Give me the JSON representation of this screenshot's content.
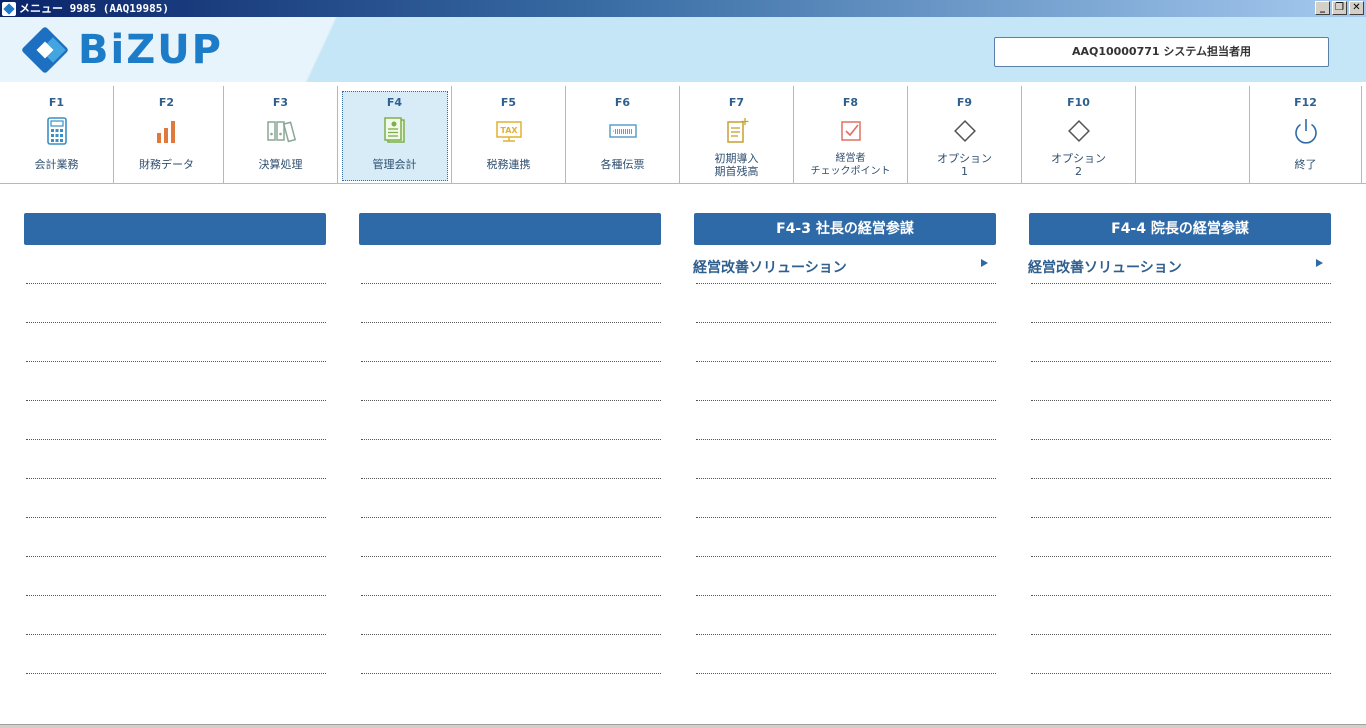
{
  "window": {
    "title": "メニュー 9985 (AAQ19985)",
    "controls": {
      "minimize": "_",
      "restore": "❐",
      "close": "✕"
    }
  },
  "header": {
    "logo_text": "BiZUP",
    "user_label": "AAQ10000771 システム担当者用"
  },
  "fkeys": [
    {
      "key": "F1",
      "label": "会計業務",
      "icon": "calculator-icon",
      "color": "#3a8fc4"
    },
    {
      "key": "F2",
      "label": "財務データ",
      "icon": "bar-chart-icon",
      "color": "#e07a3c"
    },
    {
      "key": "F3",
      "label": "決算処理",
      "icon": "binders-icon",
      "color": "#8aa894"
    },
    {
      "key": "F4",
      "label": "管理会計",
      "icon": "ledger-icon",
      "color": "#7cb04a",
      "selected": true
    },
    {
      "key": "F5",
      "label": "税務連携",
      "icon": "tax-icon",
      "color": "#e0b030"
    },
    {
      "key": "F6",
      "label": "各種伝票",
      "icon": "voucher-icon",
      "color": "#5aa0c8"
    },
    {
      "key": "F7",
      "label_line1": "初期導入",
      "label_line2": "期首残高",
      "icon": "document-plus-icon",
      "color": "#c8a030"
    },
    {
      "key": "F8",
      "label_line1": "経営者",
      "label_line2": "チェックポイント",
      "icon": "checkbox-icon",
      "color": "#e07060"
    },
    {
      "key": "F9",
      "label_line1": "オプション",
      "label_line2": "1",
      "icon": "diamond-icon",
      "color": "#555555"
    },
    {
      "key": "F10",
      "label_line1": "オプション",
      "label_line2": "2",
      "icon": "diamond-icon",
      "color": "#555555"
    },
    {
      "key": "",
      "label": ""
    },
    {
      "key": "F12",
      "label": "終了",
      "icon": "power-icon",
      "color": "#2f6aa8"
    }
  ],
  "panels": [
    {
      "title": "",
      "items": []
    },
    {
      "title": "",
      "items": []
    },
    {
      "title": "F4-3 社長の経営参謀",
      "items": [
        "経営改善ソリューション"
      ]
    },
    {
      "title": "F4-4 院長の経営参謀",
      "items": [
        "経営改善ソリューション"
      ]
    }
  ]
}
